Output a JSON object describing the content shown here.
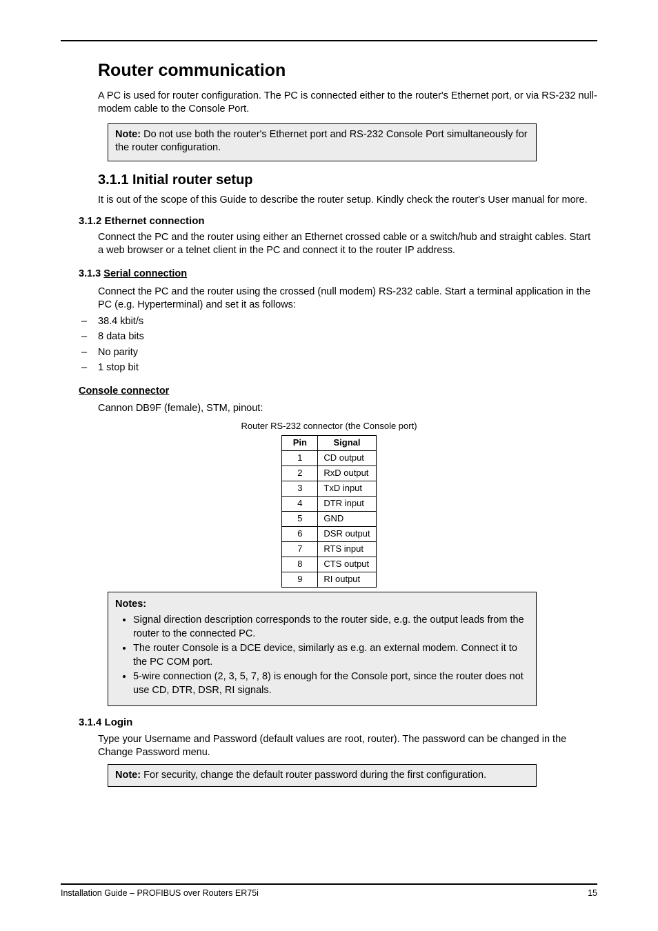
{
  "h1": "Router communication",
  "intro_p": "A PC is used for router configuration. The PC is connected either to the router's Ethernet port, or via RS-232 null-modem cable to the Console Port.",
  "note1": {
    "label": "Note:",
    "body": "Do not use both the router's Ethernet port and RS-232 Console Port simultaneously for the router configuration."
  },
  "h2": "3.1.1 Initial router setup",
  "para_initial": "It is out of the scope of this Guide to describe the router setup. Kindly check the router's User manual for more.",
  "h3": "3.1.2 Ethernet connection",
  "para_eth": "Connect the PC and the router using either an Ethernet crossed cable or a switch/hub and straight cables. Start a web browser or a telnet client in the PC and connect it to the router IP address.",
  "h4_pre": "3.1.3 ",
  "h4_link": "Serial connection",
  "para_serial": "Connect the PC and the router using the crossed (null modem) RS-232 cable. Start a terminal application in the PC (e.g. Hyperterminal) and set it as follows:",
  "serial_settings": [
    "38.4 kbit/s",
    "8 data bits",
    "No parity",
    "1 stop bit"
  ],
  "h5_console": "Console connector",
  "para_console": "Cannon DB9F (female), STM, pinout:",
  "table_caption": "Router RS-232 connector (the Console port)",
  "pin_header": {
    "pin": "Pin",
    "signal": "Signal"
  },
  "pins": [
    {
      "pin": "1",
      "signal": "CD output"
    },
    {
      "pin": "2",
      "signal": "RxD output"
    },
    {
      "pin": "3",
      "signal": "TxD input"
    },
    {
      "pin": "4",
      "signal": "DTR input"
    },
    {
      "pin": "5",
      "signal": "GND"
    },
    {
      "pin": "6",
      "signal": "DSR output"
    },
    {
      "pin": "7",
      "signal": "RTS input"
    },
    {
      "pin": "8",
      "signal": "CTS output"
    },
    {
      "pin": "9",
      "signal": "RI output"
    }
  ],
  "notes2": {
    "label": "Notes:",
    "items": [
      "Signal direction description corresponds to the router side, e.g. the output leads from the router to the connected PC.",
      "The router Console is a DCE device, similarly as e.g. an external modem. Connect it to the PC COM port.",
      "5-wire connection (2, 3, 5, 7, 8) is enough for the Console port, since the router does not use CD, DTR, DSR, RI signals."
    ]
  },
  "h3_login": "3.1.4 Login",
  "para_login": "Type your Username and Password (default values are root, router). The password can be changed in the Change Password menu.",
  "note3": {
    "label": "Note:",
    "body": "For security, change the default router password during the first configuration."
  },
  "footer": {
    "left": "Installation Guide – PROFIBUS over Routers ER75i",
    "right": "15"
  }
}
